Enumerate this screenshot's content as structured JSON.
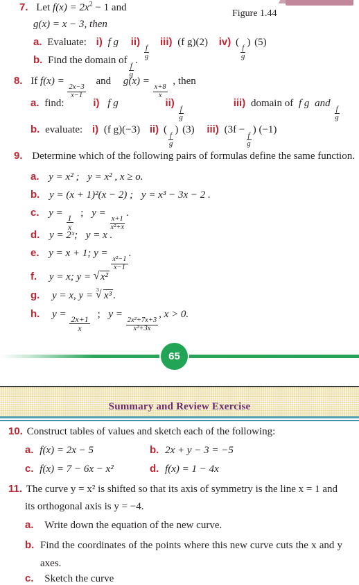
{
  "document": {
    "page_number": "65",
    "figure_caption": "Figure 1.44",
    "section_banner_title": "Summary and Review Exercise",
    "colors": {
      "label_red": "#c02432",
      "banner_purple": "#6b2a6e",
      "banner_cream": "#f2e3ac",
      "rule_teal": "#3f93a8",
      "page_badge_green": "#22a457",
      "figure_mauve": "#c3879b"
    }
  },
  "problems": {
    "p7": {
      "number": "7.",
      "stem_line1_pre": "Let ",
      "stem_line1_f": "f",
      "stem_line1_mid": "(x) = 2x",
      "stem_line1_exp": "2",
      "stem_line1_post": " − 1  and",
      "stem_line2_g": "g",
      "stem_line2_rest": "(x) = x − 3, then",
      "a_label": "a.",
      "a_text": "Evaluate:",
      "a_i": "i)",
      "a_i_expr": "f g",
      "a_ii": "ii)",
      "a_iii": "iii)",
      "a_iii_expr": "(f g)(2)",
      "a_iv": "iv)",
      "a_iv_expr": "(5)",
      "b_label": "b.",
      "b_text": "Find the domain of"
    },
    "p8": {
      "number": "8.",
      "stem_pre": "If ",
      "stem_f": "f",
      "stem_eq": "(x) =",
      "stem_frac_num": "2x−3",
      "stem_frac_den": "x−1",
      "stem_and": "and",
      "stem_g": "g",
      "stem_g_eq": "(x) =",
      "stem_g_num": "x+8",
      "stem_g_den": "x",
      "stem_then": ", then",
      "a_label": "a.",
      "a_text": "find:",
      "a_i": "i)",
      "a_i_expr": "f g",
      "a_ii": "ii)",
      "a_iii": "iii)",
      "a_iii_text": "domain of",
      "a_iii_fg": "f g",
      "a_iii_and": "and",
      "b_label": "b.",
      "b_text": "evaluate:",
      "b_i": "i)",
      "b_i_expr": "(f g)(−3)",
      "b_ii": "ii)",
      "b_ii_arg": "(3)",
      "b_iii": "iii)",
      "b_iii_pre": "(3f −",
      "b_iii_post": ") (−1)"
    },
    "p9": {
      "number": "9.",
      "stem": "Determine which of the following pairs of formulas define the same function.",
      "items": [
        {
          "label": "a.",
          "parts": [
            "y = x² ;",
            "y = x² , x ≥ o."
          ]
        },
        {
          "label": "b.",
          "parts": [
            "y = (x + 1)²(x − 2) ;",
            "y = x³ − 3x − 2 ."
          ]
        },
        {
          "label": "c.",
          "frac1_num": "1",
          "frac1_den": "x",
          "frac2_num": "x+1",
          "frac2_den": "x²+x"
        },
        {
          "label": "d.",
          "parts": [
            "y = 2ˣ;",
            "y = x ."
          ]
        },
        {
          "label": "e.",
          "lead": "y = x + 1;  y =",
          "frac_num": "x²−1",
          "frac_den": "x−1"
        },
        {
          "label": "f.",
          "lead": "y = x;  y =",
          "radicand": "x²"
        },
        {
          "label": "g.",
          "lead": "y = x,  y =",
          "radical_index": "3",
          "radicand": "x³"
        },
        {
          "label": "h.",
          "frac1_num": "2x+1",
          "frac1_den": "x",
          "frac2_num": "2x²+7x+3",
          "frac2_den": "x²+3x",
          "tail": ", x > 0."
        }
      ]
    },
    "p10": {
      "number": "10.",
      "stem": "Construct tables of values and sketch each of the following:",
      "items": [
        {
          "label": "a.",
          "text_f": "f",
          "text": "(x) = 2x − 5"
        },
        {
          "label": "b.",
          "text_f": "",
          "text": "2x + y − 3 = −5"
        },
        {
          "label": "c.",
          "text_f": "f",
          "text": "(x) = 7 − 6x − x²"
        },
        {
          "label": "d.",
          "text_f": "f",
          "text": "(x) = 1 − 4x"
        }
      ]
    },
    "p11": {
      "number": "11.",
      "stem_line1": "The curve y =  x² is shifted so that its axis of symmetry is the line x = 1 and",
      "stem_line2": "its orthogonal axis is y  =  −4.",
      "items": [
        {
          "label": "a.",
          "text": "Write down the equation of the new curve."
        },
        {
          "label": "b.",
          "text": "Find the coordinates of the points where this new curve cuts the x and y axes."
        },
        {
          "label": "c.",
          "text": "Sketch the curve"
        }
      ]
    }
  }
}
